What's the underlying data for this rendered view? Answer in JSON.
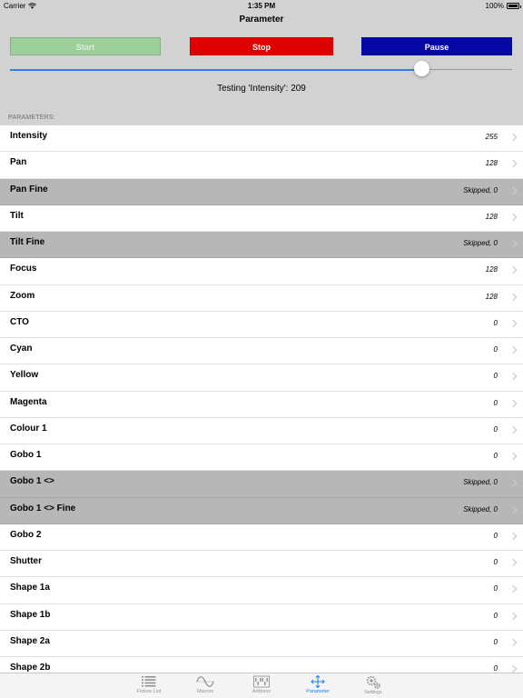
{
  "status_bar": {
    "carrier": "Carrier",
    "time": "1:35 PM",
    "battery": "100%"
  },
  "nav": {
    "title": "Parameter"
  },
  "controls": {
    "start_label": "Start",
    "stop_label": "Stop",
    "pause_label": "Pause"
  },
  "slider": {
    "value": 209,
    "max": 255
  },
  "status_text": "Testing 'Intensity': 209",
  "section_header": "PARAMETERS:",
  "parameters": [
    {
      "name": "Intensity",
      "value": "255",
      "skipped": false
    },
    {
      "name": "Pan",
      "value": "128",
      "skipped": false
    },
    {
      "name": "Pan Fine",
      "value": "Skipped, 0",
      "skipped": true
    },
    {
      "name": "Tilt",
      "value": "128",
      "skipped": false
    },
    {
      "name": "Tilt Fine",
      "value": "Skipped, 0",
      "skipped": true
    },
    {
      "name": "Focus",
      "value": "128",
      "skipped": false
    },
    {
      "name": "Zoom",
      "value": "128",
      "skipped": false
    },
    {
      "name": "CTO",
      "value": "0",
      "skipped": false
    },
    {
      "name": "Cyan",
      "value": "0",
      "skipped": false
    },
    {
      "name": "Yellow",
      "value": "0",
      "skipped": false
    },
    {
      "name": "Magenta",
      "value": "0",
      "skipped": false
    },
    {
      "name": "Colour 1",
      "value": "0",
      "skipped": false
    },
    {
      "name": "Gobo 1",
      "value": "0",
      "skipped": false
    },
    {
      "name": "Gobo 1 <>",
      "value": "Skipped, 0",
      "skipped": true
    },
    {
      "name": "Gobo 1 <> Fine",
      "value": "Skipped, 0",
      "skipped": true
    },
    {
      "name": "Gobo 2",
      "value": "0",
      "skipped": false
    },
    {
      "name": "Shutter",
      "value": "0",
      "skipped": false
    },
    {
      "name": "Shape 1a",
      "value": "0",
      "skipped": false
    },
    {
      "name": "Shape 1b",
      "value": "0",
      "skipped": false
    },
    {
      "name": "Shape 2a",
      "value": "0",
      "skipped": false
    },
    {
      "name": "Shape 2b",
      "value": "0",
      "skipped": false
    }
  ],
  "tabs": [
    {
      "label": "Fixture List",
      "icon": "list-icon",
      "active": false
    },
    {
      "label": "Macros",
      "icon": "sine-wave-icon",
      "active": false
    },
    {
      "label": "Address",
      "icon": "dip-switch-icon",
      "active": false
    },
    {
      "label": "Parameter",
      "icon": "move-arrows-icon",
      "active": true
    },
    {
      "label": "Settings",
      "icon": "gears-icon",
      "active": false
    }
  ],
  "colors": {
    "start": "#9ccf9a",
    "stop": "#df0000",
    "pause": "#0707a8",
    "accent": "#1a7ff1",
    "skipped_row": "#b7b7b7"
  }
}
